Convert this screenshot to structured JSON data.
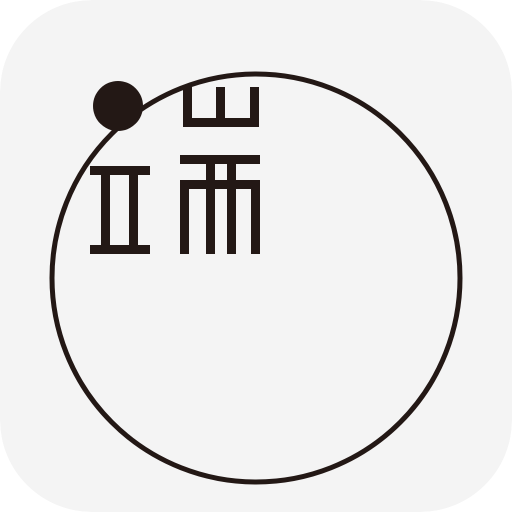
{
  "app_icon": {
    "logo_text": "瑞",
    "colors": {
      "tile_background": "#f4f4f4",
      "ink": "#231815"
    },
    "icons": {
      "tile": "app-icon-tile",
      "ring": "orbit-ring-icon",
      "dot": "orbit-dot-icon",
      "glyph": "logo-glyph-icon"
    }
  }
}
